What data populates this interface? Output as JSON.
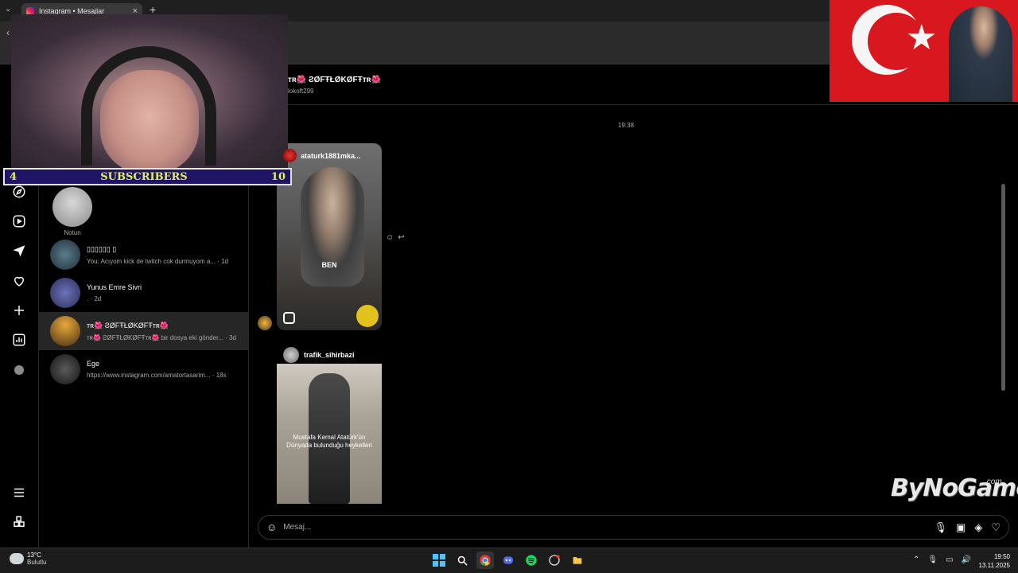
{
  "browser": {
    "tab_title": "Instagram • Mesajlar",
    "tab_close": "×",
    "new_tab": "+",
    "tab_menu": "⌄",
    "back": "‹"
  },
  "dm_list": {
    "note_label": "Notun",
    "threads": [
      {
        "name": "▯▯▯▯▯▯ ▯",
        "preview": "You: Acıyom kick de twitch cok durmuyom a... · 1d",
        "avatar_color": "#3b5a6a"
      },
      {
        "name": "Yunus Emre Sivri",
        "preview": ". · 2d",
        "avatar_color": "#4a4f8a"
      },
      {
        "name": "ᴛʀ🌺 ƧØFŦŁØKØFŦᴛʀ🌺",
        "preview": "ᴛʀ🌺 ƧØFŦŁØKØFŦᴛʀ🌺 bir dosya eki gönder... · 3d",
        "avatar_color": "#a0782a"
      },
      {
        "name": "Ege",
        "preview": "https://www.instagram.com/amatortasarim... · 18s",
        "avatar_color": "#3a3a3a"
      }
    ]
  },
  "chat": {
    "name": "ᴛʀ🌺 ƧØFŦŁØKØFŦᴛʀ🌺",
    "username": "lokoft299",
    "timestamp": "19:38",
    "post1_user": "ataturk1881mka...",
    "post1_overlay": "BEN",
    "post2_user": "trafik_sihirbazi",
    "post2_caption": "Mustafa Kemal Atatürk'ün Dünyada bulunduğu heykelleri",
    "reaction_emoji": "☺",
    "reaction_reply": "↩",
    "composer_placeholder": "Mesaj...",
    "composer_emoji": "☺",
    "actions": {
      "mic": "🎙",
      "image": "▣",
      "sticker": "◈",
      "like": "♡"
    }
  },
  "overlay": {
    "subscribers_left": "4",
    "subscribers_label": "SUBSCRIBERS",
    "subscribers_right": "10",
    "watermark": "ByNoGame",
    "watermark_suffix": ".com"
  },
  "taskbar": {
    "temperature": "13°C",
    "condition": "Bulutlu",
    "time": "19:50",
    "date": "13.11.2025",
    "tray": {
      "chevron": "⌃",
      "mic": "🎙",
      "display": "▭",
      "volume": "🔊"
    }
  },
  "colors": {
    "accent": "#0095f6",
    "background": "#000000",
    "banner": "#1f1466",
    "banner_text": "#e6f05a",
    "flag_red": "#d8181e"
  }
}
